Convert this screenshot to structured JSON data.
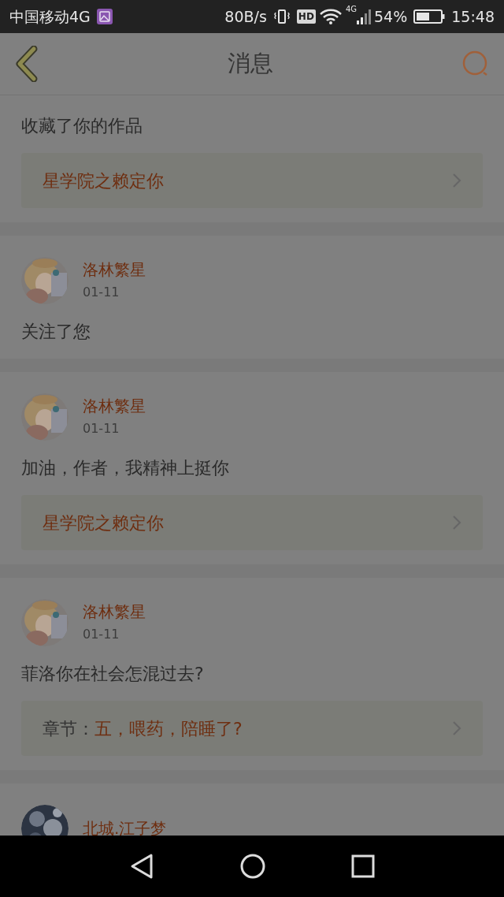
{
  "status_bar": {
    "carrier": "中国移动4G",
    "speed": "80B/s",
    "hd": "HD",
    "network": "4G",
    "battery": "54%",
    "time": "15:48"
  },
  "header": {
    "title": "消息"
  },
  "messages": [
    {
      "text": "收藏了你的作品",
      "link": {
        "title": "星学院之赖定你"
      }
    },
    {
      "user": "洛林繁星",
      "date": "01-11",
      "text": "关注了您"
    },
    {
      "user": "洛林繁星",
      "date": "01-11",
      "text": "加油，作者，我精神上挺你",
      "link": {
        "title": "星学院之赖定你"
      }
    },
    {
      "user": "洛林繁星",
      "date": "01-11",
      "text": "菲洛你在社会怎混过去?",
      "link": {
        "prefix": "章节：",
        "title": "五，喂药，陪睡了?"
      }
    },
    {
      "user": "北城.江子梦"
    }
  ]
}
